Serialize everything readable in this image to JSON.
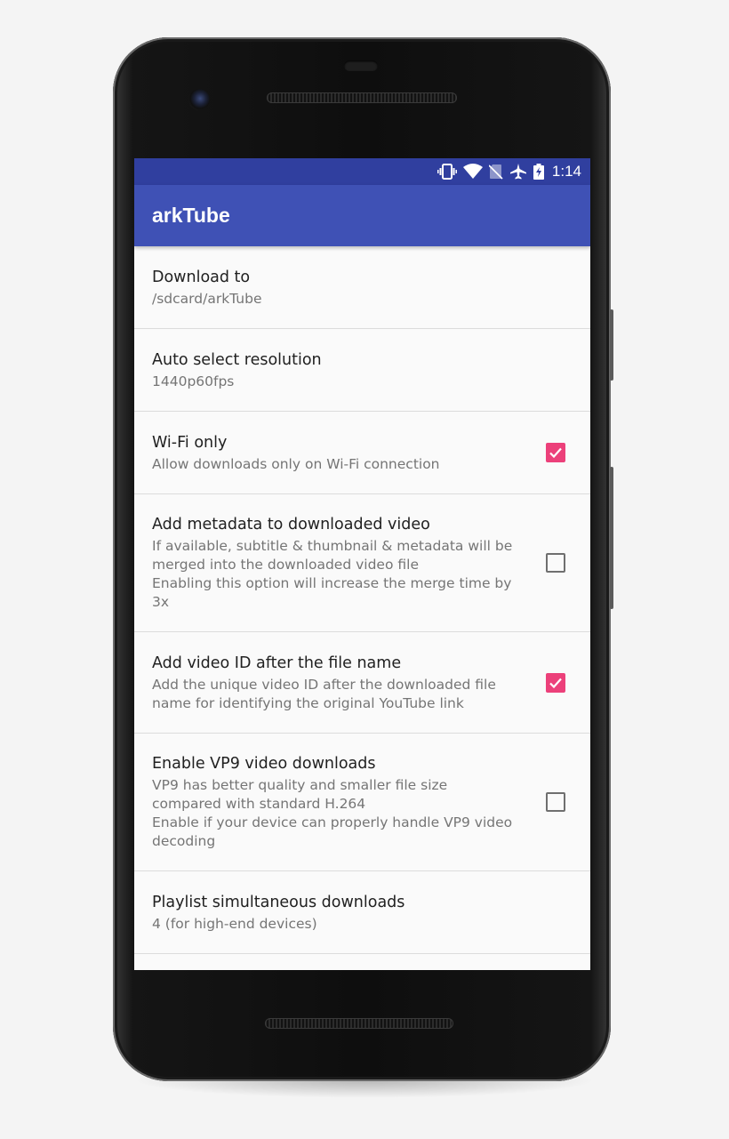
{
  "status_bar": {
    "time": "1:14",
    "icons": [
      "vibrate-icon",
      "wifi-icon",
      "no-sim-icon",
      "airplane-mode-icon",
      "battery-charging-icon"
    ]
  },
  "app_bar": {
    "title": "arkTube"
  },
  "colors": {
    "primary": "#3f51b5",
    "primary_dark": "#303f9f",
    "accent": "#ec407a"
  },
  "preferences": [
    {
      "title": "Download to",
      "summary": "/sdcard/arkTube",
      "checkbox": null
    },
    {
      "title": "Auto select resolution",
      "summary": "1440p60fps",
      "checkbox": null
    },
    {
      "title": "Wi-Fi only",
      "summary": "Allow downloads only on Wi-Fi connection",
      "checkbox": true
    },
    {
      "title": "Add metadata to downloaded video",
      "summary": "If available, subtitle & thumbnail & metadata will be merged into the downloaded video file\nEnabling this option will increase the merge time by 3x",
      "checkbox": false
    },
    {
      "title": "Add video ID after the file name",
      "summary": "Add the unique video ID after the downloaded file name for identifying the original YouTube link",
      "checkbox": true
    },
    {
      "title": "Enable VP9 video downloads",
      "summary": "VP9 has better quality and smaller file size compared with standard H.264\nEnable if your device can properly handle VP9 video decoding",
      "checkbox": false
    },
    {
      "title": "Playlist simultaneous downloads",
      "summary": "4 (for high-end devices)",
      "checkbox": null
    }
  ]
}
